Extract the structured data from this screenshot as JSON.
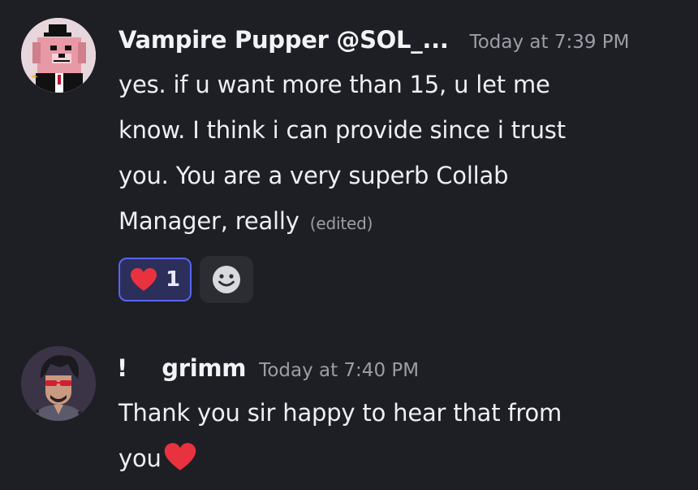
{
  "messages": [
    {
      "username": "Vampire Pupper @SOL_...",
      "timestamp": "Today at 7:39 PM",
      "lines": [
        "yes. if u want more than 15,  u let me",
        "know. I think i can provide since i trust",
        "you. You are a very superb Collab",
        "Manager, really"
      ],
      "edited_label": "(edited)",
      "reactions": [
        {
          "icon": "heart-icon",
          "count": "1",
          "color": "#e8323f"
        }
      ],
      "add_reaction_icon": "smiley-face-icon"
    },
    {
      "prefix": "!",
      "username": "grimm",
      "timestamp": "Today at 7:40 PM",
      "lines": [
        "Thank you sir happy to hear that from",
        "you"
      ],
      "trailing_emoji": "heart-icon"
    }
  ],
  "colors": {
    "background": "#1e1f25",
    "accent": "#5865f2",
    "heart": "#e8323f",
    "muted_text": "#9b9ea6"
  }
}
